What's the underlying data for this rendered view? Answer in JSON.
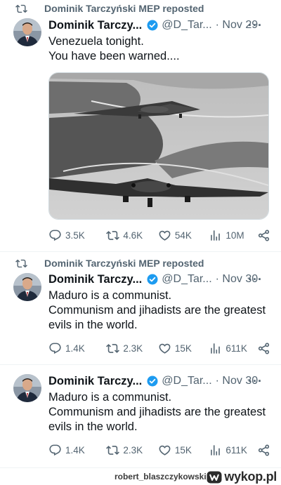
{
  "posts": [
    {
      "repost_label": "Dominik Tarczyński MEP reposted",
      "name": "Dominik Tarczy...",
      "handle": "@D_Tar...",
      "date": "· Nov 29",
      "more": "···",
      "lines": [
        "Venezuela tonight.",
        "You have been warned...."
      ],
      "has_media": true,
      "stats": {
        "replies": "3.5K",
        "reposts": "4.6K",
        "likes": "54K",
        "views": "10M"
      }
    },
    {
      "repost_label": "Dominik Tarczyński MEP reposted",
      "name": "Dominik Tarczy...",
      "handle": "@D_Tar...",
      "date": "· Nov 30",
      "more": "···",
      "lines": [
        "Maduro is a communist.",
        "Communism and jihadists are the greatest",
        "evils in the world."
      ],
      "has_media": false,
      "stats": {
        "replies": "1.4K",
        "reposts": "2.3K",
        "likes": "15K",
        "views": "611K"
      }
    },
    {
      "name": "Dominik Tarczy...",
      "handle": "@D_Tar...",
      "date": "· Nov 30",
      "more": "···",
      "lines": [
        "Maduro is a communist.",
        "Communism and jihadists are the greatest",
        "evils in the world."
      ],
      "has_media": false,
      "stats": {
        "replies": "1.4K",
        "reposts": "2.3K",
        "likes": "15K",
        "views": "611K"
      }
    }
  ],
  "footer": {
    "username": "robert_blaszczykowski z",
    "site": "wykop.pl"
  },
  "colors": {
    "text": "#0f1419",
    "secondary": "#536471",
    "verified": "#1d9bf0",
    "divider": "#eff3f4"
  },
  "icons": [
    "repost-icon",
    "verified-badge-icon",
    "reply-icon",
    "like-icon",
    "views-icon",
    "share-icon",
    "more-icon",
    "wykop-logo-icon"
  ]
}
